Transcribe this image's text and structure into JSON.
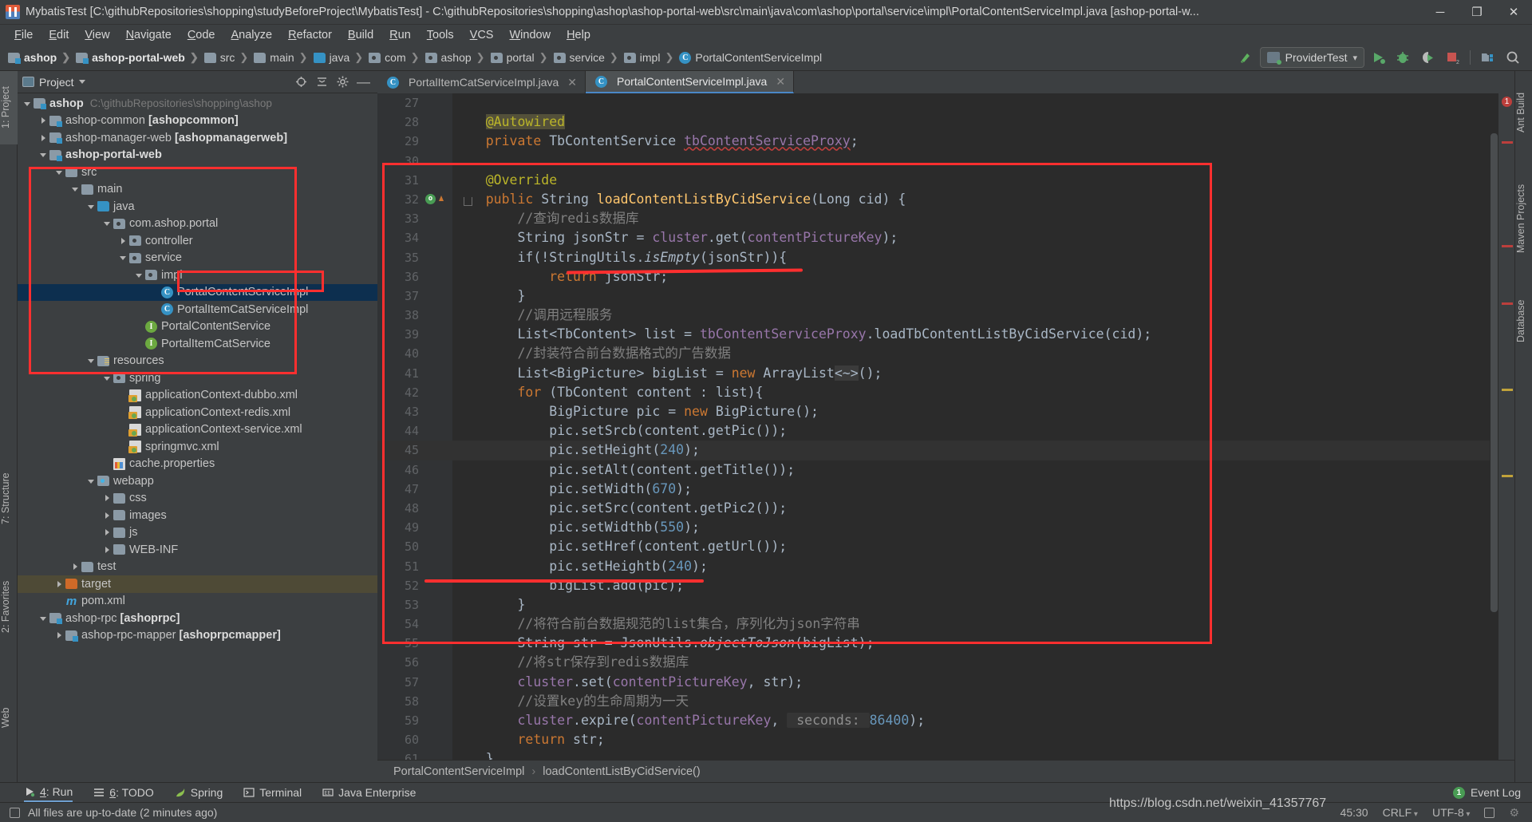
{
  "window": {
    "title": "MybatisTest [C:\\githubRepositories\\shopping\\studyBeforeProject\\MybatisTest] - C:\\githubRepositories\\shopping\\ashop\\ashop-portal-web\\src\\main\\java\\com\\ashop\\portal\\service\\impl\\PortalContentServiceImpl.java [ashop-portal-w...",
    "minimize": "─",
    "maximize": "❐",
    "close": "✕"
  },
  "menu": [
    "File",
    "Edit",
    "View",
    "Navigate",
    "Code",
    "Analyze",
    "Refactor",
    "Build",
    "Run",
    "Tools",
    "VCS",
    "Window",
    "Help"
  ],
  "navbar": {
    "crumbs": [
      {
        "label": "ashop",
        "icon": "module-folder-icon",
        "bold": true
      },
      {
        "label": "ashop-portal-web",
        "icon": "module-folder-icon",
        "bold": true
      },
      {
        "label": "src",
        "icon": "folder-icon",
        "bold": false
      },
      {
        "label": "main",
        "icon": "folder-icon",
        "bold": false
      },
      {
        "label": "java",
        "icon": "source-folder-icon",
        "bold": false
      },
      {
        "label": "com",
        "icon": "package-icon",
        "bold": false
      },
      {
        "label": "ashop",
        "icon": "package-icon",
        "bold": false
      },
      {
        "label": "portal",
        "icon": "package-icon",
        "bold": false
      },
      {
        "label": "service",
        "icon": "package-icon",
        "bold": false
      },
      {
        "label": "impl",
        "icon": "package-icon",
        "bold": false
      },
      {
        "label": "PortalContentServiceImpl",
        "icon": "class-icon",
        "bold": false
      }
    ],
    "run_config": "ProviderTest",
    "run_config_caret": "▾",
    "stop_badge": "2"
  },
  "left_tabs": [
    {
      "label": "1: Project",
      "active": true
    },
    {
      "label": "7: Structure",
      "active": false
    },
    {
      "label": "2: Favorites",
      "active": false
    },
    {
      "label": "Web",
      "active": false
    }
  ],
  "right_tabs": [
    {
      "label": "Ant Build"
    },
    {
      "label": "Maven Projects"
    },
    {
      "label": "Database"
    }
  ],
  "project_panel": {
    "title": "Project",
    "caret": "▾",
    "header_icons": [
      "target-icon",
      "collapse-all-icon",
      "gear-icon",
      "hide-icon"
    ],
    "tree": [
      {
        "depth": 0,
        "arrow": "down",
        "icon": "module-folder-icon",
        "label": "ashop",
        "bold": true,
        "path": "C:\\githubRepositories\\shopping\\ashop"
      },
      {
        "depth": 1,
        "arrow": "right",
        "icon": "module-folder-icon",
        "label": "ashop-common ",
        "suffix": "[ashopcommon]"
      },
      {
        "depth": 1,
        "arrow": "right",
        "icon": "module-folder-icon",
        "label": "ashop-manager-web ",
        "suffix": "[ashopmanagerweb]"
      },
      {
        "depth": 1,
        "arrow": "down",
        "icon": "module-folder-icon",
        "label": "ashop-portal-web",
        "bold": true
      },
      {
        "depth": 2,
        "arrow": "down",
        "icon": "folder-icon",
        "label": "src"
      },
      {
        "depth": 3,
        "arrow": "down",
        "icon": "folder-icon",
        "label": "main"
      },
      {
        "depth": 4,
        "arrow": "down",
        "icon": "source-folder-icon",
        "label": "java"
      },
      {
        "depth": 5,
        "arrow": "down",
        "icon": "package-icon",
        "label": "com.ashop.portal"
      },
      {
        "depth": 6,
        "arrow": "right",
        "icon": "package-icon",
        "label": "controller"
      },
      {
        "depth": 6,
        "arrow": "down",
        "icon": "package-icon",
        "label": "service"
      },
      {
        "depth": 7,
        "arrow": "down",
        "icon": "package-icon",
        "label": "impl"
      },
      {
        "depth": 8,
        "arrow": "none",
        "icon": "class-icon",
        "label": "PortalContentServiceImpl",
        "selected": true
      },
      {
        "depth": 8,
        "arrow": "none",
        "icon": "class-icon",
        "label": "PortalItemCatServiceImpl"
      },
      {
        "depth": 7,
        "arrow": "none",
        "icon": "interface-icon",
        "label": "PortalContentService"
      },
      {
        "depth": 7,
        "arrow": "none",
        "icon": "interface-icon",
        "label": "PortalItemCatService"
      },
      {
        "depth": 4,
        "arrow": "down",
        "icon": "resources-folder-icon",
        "label": "resources"
      },
      {
        "depth": 5,
        "arrow": "down",
        "icon": "package-icon",
        "label": "spring"
      },
      {
        "depth": 6,
        "arrow": "none",
        "icon": "spring-xml-icon",
        "label": "applicationContext-dubbo.xml"
      },
      {
        "depth": 6,
        "arrow": "none",
        "icon": "spring-xml-icon",
        "label": "applicationContext-redis.xml"
      },
      {
        "depth": 6,
        "arrow": "none",
        "icon": "spring-xml-icon",
        "label": "applicationContext-service.xml"
      },
      {
        "depth": 6,
        "arrow": "none",
        "icon": "spring-xml-icon",
        "label": "springmvc.xml"
      },
      {
        "depth": 5,
        "arrow": "none",
        "icon": "properties-icon",
        "label": "cache.properties"
      },
      {
        "depth": 4,
        "arrow": "down",
        "icon": "webapp-folder-icon",
        "label": "webapp"
      },
      {
        "depth": 5,
        "arrow": "right",
        "icon": "folder-icon",
        "label": "css"
      },
      {
        "depth": 5,
        "arrow": "right",
        "icon": "folder-icon",
        "label": "images"
      },
      {
        "depth": 5,
        "arrow": "right",
        "icon": "folder-icon",
        "label": "js"
      },
      {
        "depth": 5,
        "arrow": "right",
        "icon": "folder-icon",
        "label": "WEB-INF"
      },
      {
        "depth": 3,
        "arrow": "right",
        "icon": "folder-icon",
        "label": "test"
      },
      {
        "depth": 2,
        "arrow": "right",
        "icon": "excluded-folder-icon",
        "label": "target",
        "highlight": true
      },
      {
        "depth": 2,
        "arrow": "none",
        "icon": "maven-pom-icon",
        "label": "pom.xml"
      },
      {
        "depth": 1,
        "arrow": "down",
        "icon": "module-folder-icon",
        "label": "ashop-rpc ",
        "suffix": "[ashoprpc]"
      },
      {
        "depth": 2,
        "arrow": "right",
        "icon": "module-folder-icon",
        "label": "ashop-rpc-mapper ",
        "suffix": "[ashoprpcmapper]"
      }
    ]
  },
  "editor": {
    "tabs": [
      {
        "label": "PortalItemCatServiceImpl.java",
        "icon": "class-icon",
        "active": false,
        "close": "✕"
      },
      {
        "label": "PortalContentServiceImpl.java",
        "icon": "class-icon",
        "active": true,
        "close": "✕"
      }
    ],
    "first_line": 27,
    "error_count": "1",
    "lines": [
      {
        "n": 27,
        "tokens": []
      },
      {
        "n": 28,
        "tokens": [
          {
            "t": "    ",
            "c": "st"
          },
          {
            "t": "@Autowired",
            "c": "anhl"
          }
        ]
      },
      {
        "n": 29,
        "tokens": [
          {
            "t": "    ",
            "c": "st"
          },
          {
            "t": "private",
            "c": "k"
          },
          {
            "t": " TbContentService ",
            "c": "st"
          },
          {
            "t": "tbContentServiceProxy",
            "c": "fld wavy"
          },
          {
            "t": ";",
            "c": "st"
          }
        ]
      },
      {
        "n": 30,
        "tokens": []
      },
      {
        "n": 31,
        "tokens": [
          {
            "t": "    ",
            "c": "st"
          },
          {
            "t": "@Override",
            "c": "an"
          }
        ]
      },
      {
        "n": 32,
        "tokens": [
          {
            "t": "    ",
            "c": "st"
          },
          {
            "t": "public",
            "c": "k"
          },
          {
            "t": " String ",
            "c": "st"
          },
          {
            "t": "loadContentListByCidService",
            "c": "mth"
          },
          {
            "t": "(Long cid) {",
            "c": "st"
          }
        ],
        "gutter": "override",
        "fold": true
      },
      {
        "n": 33,
        "tokens": [
          {
            "t": "        //查询redis数据库",
            "c": "cm"
          }
        ]
      },
      {
        "n": 34,
        "tokens": [
          {
            "t": "        String jsonStr = ",
            "c": "st"
          },
          {
            "t": "cluster",
            "c": "fld"
          },
          {
            "t": ".get(",
            "c": "st"
          },
          {
            "t": "contentPictureKey",
            "c": "fld"
          },
          {
            "t": ");",
            "c": "st"
          }
        ]
      },
      {
        "n": 35,
        "tokens": [
          {
            "t": "        if(!StringUtils.",
            "c": "st"
          },
          {
            "t": "isEmpty",
            "c": "em"
          },
          {
            "t": "(jsonStr)){",
            "c": "st"
          }
        ]
      },
      {
        "n": 36,
        "tokens": [
          {
            "t": "            ",
            "c": "st"
          },
          {
            "t": "return",
            "c": "k"
          },
          {
            "t": " jsonStr;",
            "c": "st"
          }
        ]
      },
      {
        "n": 37,
        "tokens": [
          {
            "t": "        }",
            "c": "st"
          }
        ]
      },
      {
        "n": 38,
        "tokens": [
          {
            "t": "        //调用远程服务",
            "c": "cm"
          }
        ]
      },
      {
        "n": 39,
        "tokens": [
          {
            "t": "        List<TbContent> list = ",
            "c": "st"
          },
          {
            "t": "tbContentServiceProxy",
            "c": "fld"
          },
          {
            "t": ".loadTbContentListByCidService(cid);",
            "c": "st"
          }
        ]
      },
      {
        "n": 40,
        "tokens": [
          {
            "t": "        //封装符合前台数据格式的广告数据",
            "c": "cm"
          }
        ]
      },
      {
        "n": 41,
        "tokens": [
          {
            "t": "        List<BigPicture> bigList = ",
            "c": "st"
          },
          {
            "t": "new",
            "c": "k"
          },
          {
            "t": " ArrayList",
            "c": "st"
          },
          {
            "t": "<~>",
            "c": "diam"
          },
          {
            "t": "();",
            "c": "st"
          }
        ]
      },
      {
        "n": 42,
        "tokens": [
          {
            "t": "        ",
            "c": "st"
          },
          {
            "t": "for",
            "c": "k"
          },
          {
            "t": " (TbContent content : list){",
            "c": "st"
          }
        ]
      },
      {
        "n": 43,
        "tokens": [
          {
            "t": "            BigPicture pic = ",
            "c": "st"
          },
          {
            "t": "new",
            "c": "k"
          },
          {
            "t": " BigPicture();",
            "c": "st"
          }
        ]
      },
      {
        "n": 44,
        "tokens": [
          {
            "t": "            pic.setSrcb(content.getPic());",
            "c": "st"
          }
        ]
      },
      {
        "n": 45,
        "tokens": [
          {
            "t": "            pic.setHeight(",
            "c": "st"
          },
          {
            "t": "240",
            "c": "num"
          },
          {
            "t": ");",
            "c": "st"
          }
        ],
        "current": true
      },
      {
        "n": 46,
        "tokens": [
          {
            "t": "            pic.setAlt(content.getTitle());",
            "c": "st"
          }
        ]
      },
      {
        "n": 47,
        "tokens": [
          {
            "t": "            pic.setWidth(",
            "c": "st"
          },
          {
            "t": "670",
            "c": "num"
          },
          {
            "t": ");",
            "c": "st"
          }
        ]
      },
      {
        "n": 48,
        "tokens": [
          {
            "t": "            pic.setSrc(content.getPic2());",
            "c": "st"
          }
        ]
      },
      {
        "n": 49,
        "tokens": [
          {
            "t": "            pic.setWidthb(",
            "c": "st"
          },
          {
            "t": "550",
            "c": "num"
          },
          {
            "t": ");",
            "c": "st"
          }
        ]
      },
      {
        "n": 50,
        "tokens": [
          {
            "t": "            pic.setHref(content.getUrl());",
            "c": "st"
          }
        ]
      },
      {
        "n": 51,
        "tokens": [
          {
            "t": "            pic.setHeightb(",
            "c": "st"
          },
          {
            "t": "240",
            "c": "num"
          },
          {
            "t": ");",
            "c": "st"
          }
        ]
      },
      {
        "n": 52,
        "tokens": [
          {
            "t": "            bigList.add(pic);",
            "c": "st"
          }
        ]
      },
      {
        "n": 53,
        "tokens": [
          {
            "t": "        }",
            "c": "st"
          }
        ]
      },
      {
        "n": 54,
        "tokens": [
          {
            "t": "        //将符合前台数据规范的list集合，序列化为json字符串",
            "c": "cm"
          }
        ]
      },
      {
        "n": 55,
        "tokens": [
          {
            "t": "        String str = JsonUtils.",
            "c": "st"
          },
          {
            "t": "objectToJson",
            "c": "em"
          },
          {
            "t": "(bigList);",
            "c": "st"
          }
        ]
      },
      {
        "n": 56,
        "tokens": [
          {
            "t": "        //将str保存到redis数据库",
            "c": "cm"
          }
        ]
      },
      {
        "n": 57,
        "tokens": [
          {
            "t": "        ",
            "c": "st"
          },
          {
            "t": "cluster",
            "c": "fld"
          },
          {
            "t": ".set(",
            "c": "st"
          },
          {
            "t": "contentPictureKey",
            "c": "fld"
          },
          {
            "t": ", str);",
            "c": "st"
          }
        ]
      },
      {
        "n": 58,
        "tokens": [
          {
            "t": "        //设置key的生命周期为一天",
            "c": "cm"
          }
        ]
      },
      {
        "n": 59,
        "tokens": [
          {
            "t": "        ",
            "c": "st"
          },
          {
            "t": "cluster",
            "c": "fld"
          },
          {
            "t": ".expire(",
            "c": "st"
          },
          {
            "t": "contentPictureKey",
            "c": "fld"
          },
          {
            "t": ", ",
            "c": "st"
          },
          {
            "t": " seconds: ",
            "c": "hint"
          },
          {
            "t": "86400",
            "c": "num"
          },
          {
            "t": ");",
            "c": "st"
          }
        ]
      },
      {
        "n": 60,
        "tokens": [
          {
            "t": "        ",
            "c": "st"
          },
          {
            "t": "return",
            "c": "k"
          },
          {
            "t": " str;",
            "c": "st"
          }
        ]
      },
      {
        "n": 61,
        "tokens": [
          {
            "t": "    }",
            "c": "st"
          }
        ]
      }
    ]
  },
  "bottom_breadcrumb": {
    "class": "PortalContentServiceImpl",
    "separator": "›",
    "method": "loadContentListByCidService()"
  },
  "tool_windows": [
    {
      "label": "4: Run",
      "icon": "run-icon",
      "active": true
    },
    {
      "label": "6: TODO",
      "icon": "todo-icon",
      "active": false
    },
    {
      "label": "Spring",
      "icon": "spring-icon",
      "active": false
    },
    {
      "label": "Terminal",
      "icon": "terminal-icon",
      "active": false
    },
    {
      "label": "Java Enterprise",
      "icon": "java-enterprise-icon",
      "active": false
    }
  ],
  "event_log": {
    "count": "1",
    "label": "Event Log"
  },
  "status_bar": {
    "message": "All files are up-to-date (2 minutes ago)",
    "position": "45:30",
    "line_separator": "CRLF",
    "encoding": "UTF-8",
    "caret": "▾"
  },
  "watermark": "https://blog.csdn.net/weixin_41357767",
  "colors": {
    "annotation_red": "#ff2f2f",
    "accent_blue": "#3592c4",
    "selection_blue": "#0d2f4f",
    "editor_bg": "#2b2b2b",
    "chrome_bg": "#3c3f41"
  }
}
